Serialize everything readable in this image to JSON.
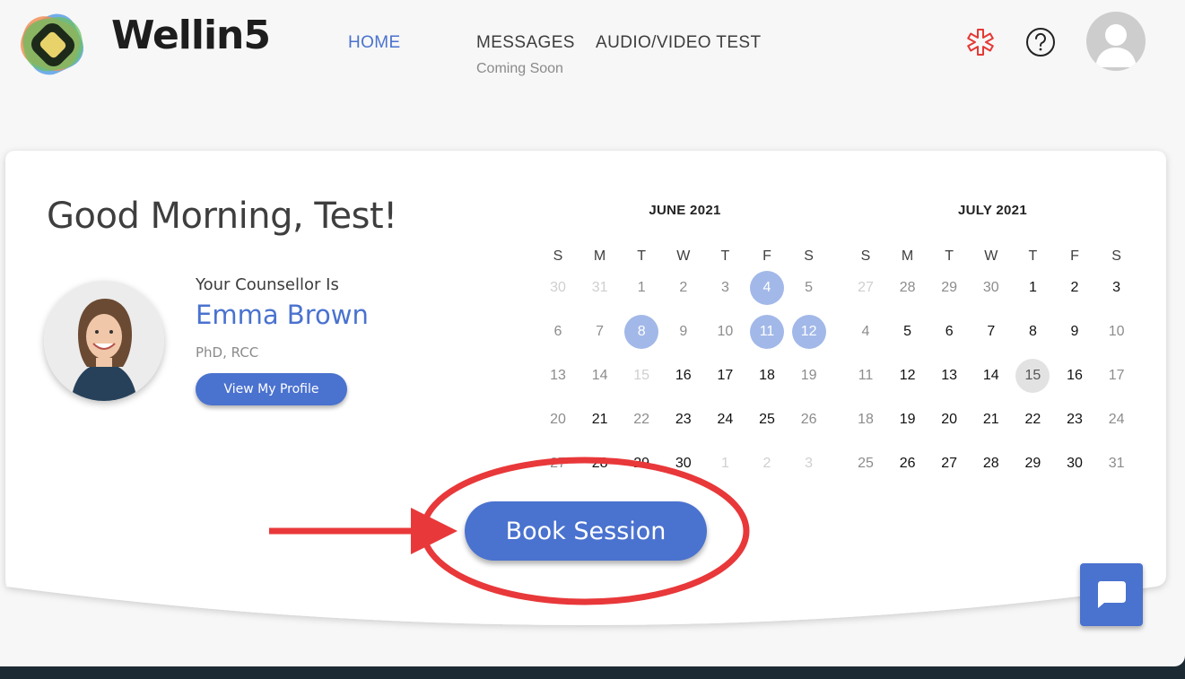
{
  "brand": {
    "name": "Wellin5",
    "logo_icon": "layered-diamond-logo"
  },
  "nav": {
    "home": "HOME",
    "messages": "MESSAGES",
    "messages_sub": "Coming Soon",
    "audio_video": "AUDIO/VIDEO TEST",
    "active": "home"
  },
  "header_icons": [
    "emergency-star-icon",
    "help-icon",
    "user-avatar"
  ],
  "colors": {
    "accent": "#4a72cf",
    "selected_day": "#a2b8e8",
    "today": "#e2e2e2",
    "annotation": "#e8383a",
    "emergency": "#e53935"
  },
  "greeting": "Good Morning, Test!",
  "counsellor": {
    "label": "Your Counsellor Is",
    "name": "Emma Brown",
    "credentials": "PhD, RCC",
    "profile_button": "View My Profile"
  },
  "weekdays": [
    "S",
    "M",
    "T",
    "W",
    "T",
    "F",
    "S"
  ],
  "calendars": [
    {
      "id": "june",
      "title": "JUNE 2021",
      "weeks": [
        [
          {
            "d": "30",
            "s": "out"
          },
          {
            "d": "31",
            "s": "out"
          },
          {
            "d": "1",
            "s": "past"
          },
          {
            "d": "2",
            "s": "past"
          },
          {
            "d": "3",
            "s": "past"
          },
          {
            "d": "4",
            "s": "selected"
          },
          {
            "d": "5",
            "s": "past"
          }
        ],
        [
          {
            "d": "6",
            "s": "past"
          },
          {
            "d": "7",
            "s": "past"
          },
          {
            "d": "8",
            "s": "selected"
          },
          {
            "d": "9",
            "s": "past"
          },
          {
            "d": "10",
            "s": "past"
          },
          {
            "d": "11",
            "s": "selected"
          },
          {
            "d": "12",
            "s": "selected"
          }
        ],
        [
          {
            "d": "13",
            "s": "past"
          },
          {
            "d": "14",
            "s": "past"
          },
          {
            "d": "15",
            "s": "out"
          },
          {
            "d": "16",
            "s": "avail"
          },
          {
            "d": "17",
            "s": "avail"
          },
          {
            "d": "18",
            "s": "avail"
          },
          {
            "d": "19",
            "s": "past"
          }
        ],
        [
          {
            "d": "20",
            "s": "past"
          },
          {
            "d": "21",
            "s": "avail"
          },
          {
            "d": "22",
            "s": "past"
          },
          {
            "d": "23",
            "s": "avail"
          },
          {
            "d": "24",
            "s": "avail"
          },
          {
            "d": "25",
            "s": "avail"
          },
          {
            "d": "26",
            "s": "past"
          }
        ],
        [
          {
            "d": "27",
            "s": "past"
          },
          {
            "d": "28",
            "s": "avail"
          },
          {
            "d": "29",
            "s": "avail"
          },
          {
            "d": "30",
            "s": "avail"
          },
          {
            "d": "1",
            "s": "out"
          },
          {
            "d": "2",
            "s": "out"
          },
          {
            "d": "3",
            "s": "out"
          }
        ]
      ]
    },
    {
      "id": "july",
      "title": "JULY 2021",
      "weeks": [
        [
          {
            "d": "27",
            "s": "out"
          },
          {
            "d": "28",
            "s": "past"
          },
          {
            "d": "29",
            "s": "past"
          },
          {
            "d": "30",
            "s": "past"
          },
          {
            "d": "1",
            "s": "avail"
          },
          {
            "d": "2",
            "s": "avail"
          },
          {
            "d": "3",
            "s": "avail"
          }
        ],
        [
          {
            "d": "4",
            "s": "past"
          },
          {
            "d": "5",
            "s": "avail"
          },
          {
            "d": "6",
            "s": "avail"
          },
          {
            "d": "7",
            "s": "avail"
          },
          {
            "d": "8",
            "s": "avail"
          },
          {
            "d": "9",
            "s": "avail"
          },
          {
            "d": "10",
            "s": "past"
          }
        ],
        [
          {
            "d": "11",
            "s": "past"
          },
          {
            "d": "12",
            "s": "avail"
          },
          {
            "d": "13",
            "s": "avail"
          },
          {
            "d": "14",
            "s": "avail"
          },
          {
            "d": "15",
            "s": "today"
          },
          {
            "d": "16",
            "s": "avail"
          },
          {
            "d": "17",
            "s": "past"
          }
        ],
        [
          {
            "d": "18",
            "s": "past"
          },
          {
            "d": "19",
            "s": "avail"
          },
          {
            "d": "20",
            "s": "avail"
          },
          {
            "d": "21",
            "s": "avail"
          },
          {
            "d": "22",
            "s": "avail"
          },
          {
            "d": "23",
            "s": "avail"
          },
          {
            "d": "24",
            "s": "past"
          }
        ],
        [
          {
            "d": "25",
            "s": "past"
          },
          {
            "d": "26",
            "s": "avail"
          },
          {
            "d": "27",
            "s": "avail"
          },
          {
            "d": "28",
            "s": "avail"
          },
          {
            "d": "29",
            "s": "avail"
          },
          {
            "d": "30",
            "s": "avail"
          },
          {
            "d": "31",
            "s": "past"
          }
        ]
      ]
    }
  ],
  "book_button": "Book Session",
  "chat_icon": "chat-bubble-icon"
}
